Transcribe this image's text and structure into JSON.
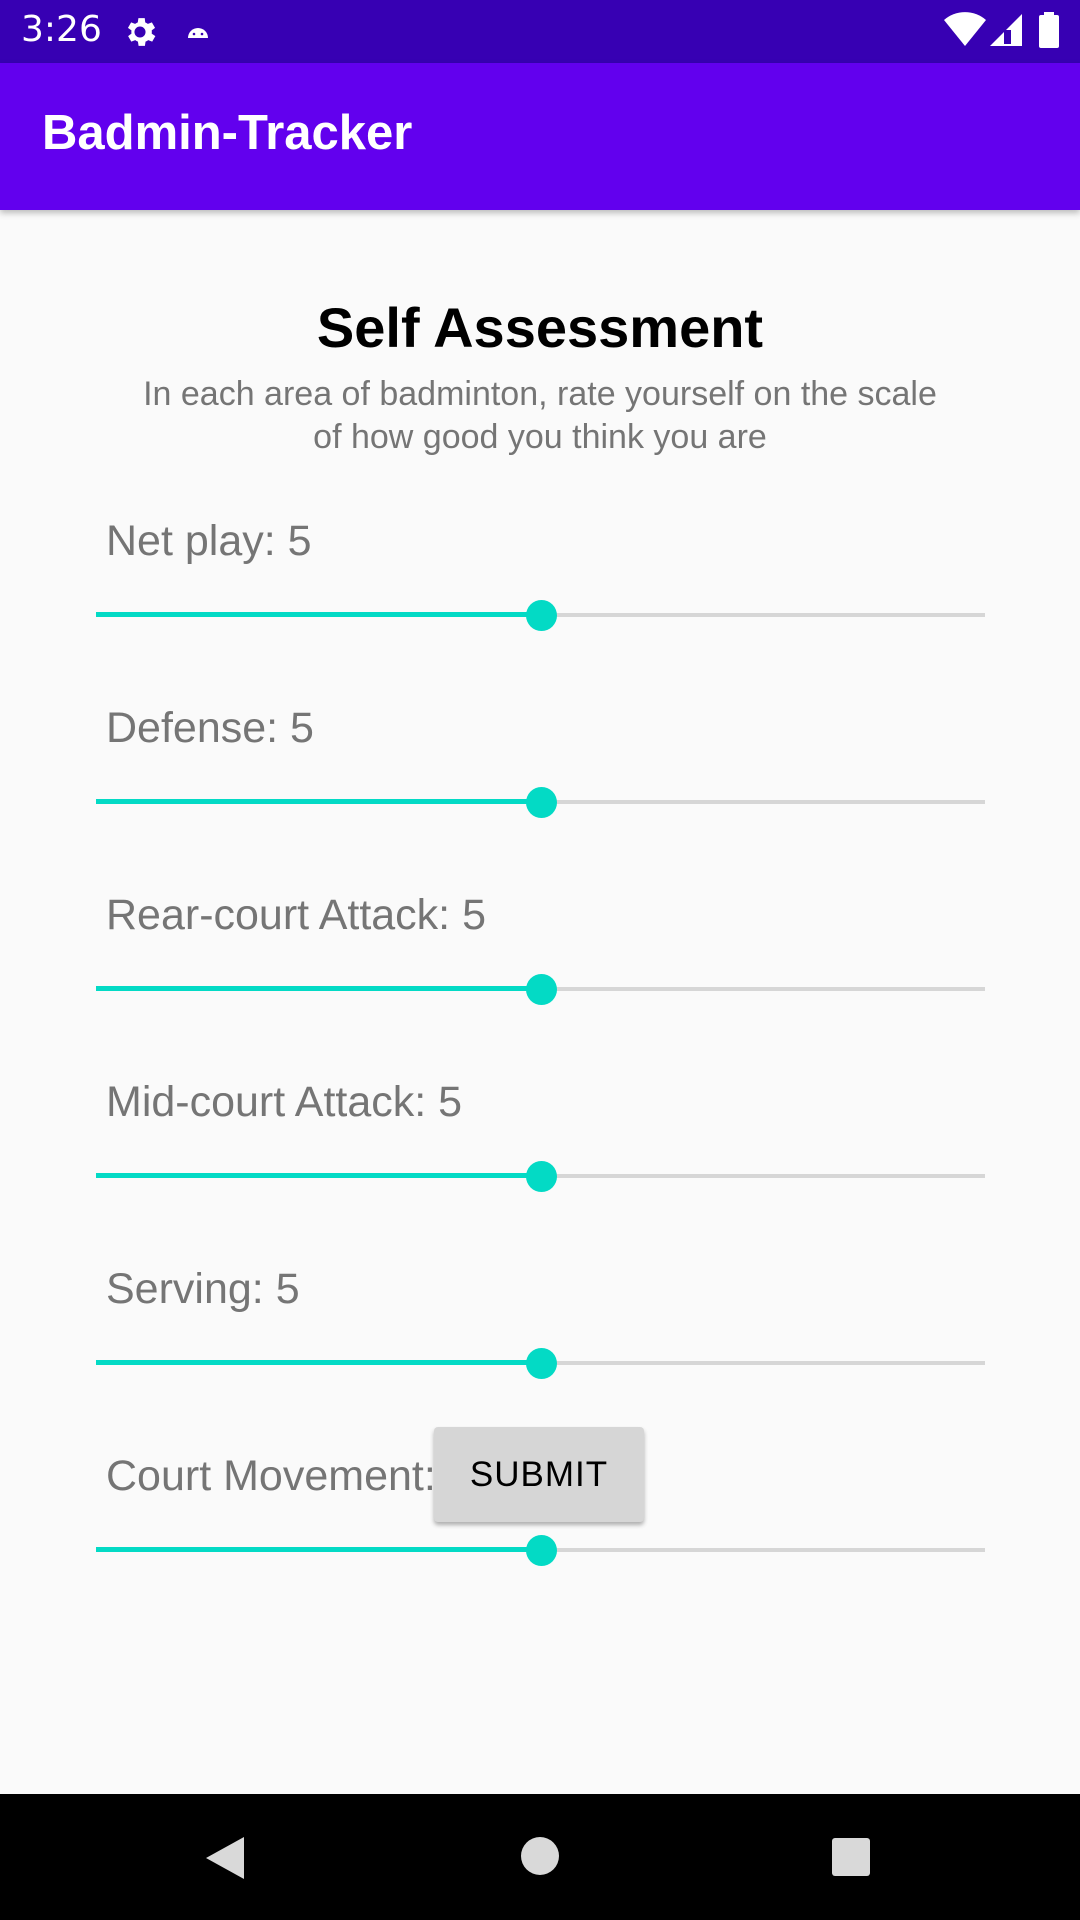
{
  "status_bar": {
    "time": "3:26",
    "icons": [
      "gear-icon",
      "android-icon",
      "wifi-icon",
      "signal-icon",
      "battery-icon"
    ],
    "background": "#3700b3"
  },
  "app_bar": {
    "title": "Badmin-Tracker",
    "background": "#6200ee"
  },
  "main": {
    "title": "Self Assessment",
    "subtitle": "In each area of badminton, rate yourself on the scale of how good you think you are",
    "sliders": [
      {
        "label": "Net play: 5",
        "value": 5,
        "max": 10
      },
      {
        "label": "Defense: 5",
        "value": 5,
        "max": 10
      },
      {
        "label": "Rear-court Attack: 5",
        "value": 5,
        "max": 10
      },
      {
        "label": "Mid-court Attack: 5",
        "value": 5,
        "max": 10
      },
      {
        "label": "Serving: 5",
        "value": 5,
        "max": 10
      },
      {
        "label": "Court Movement: 5",
        "value": 5,
        "max": 10
      }
    ],
    "submit_label": "SUBMIT",
    "accent_color": "#03dac5"
  },
  "nav_bar": {
    "icons": [
      "back-icon",
      "home-icon",
      "recents-icon"
    ]
  }
}
